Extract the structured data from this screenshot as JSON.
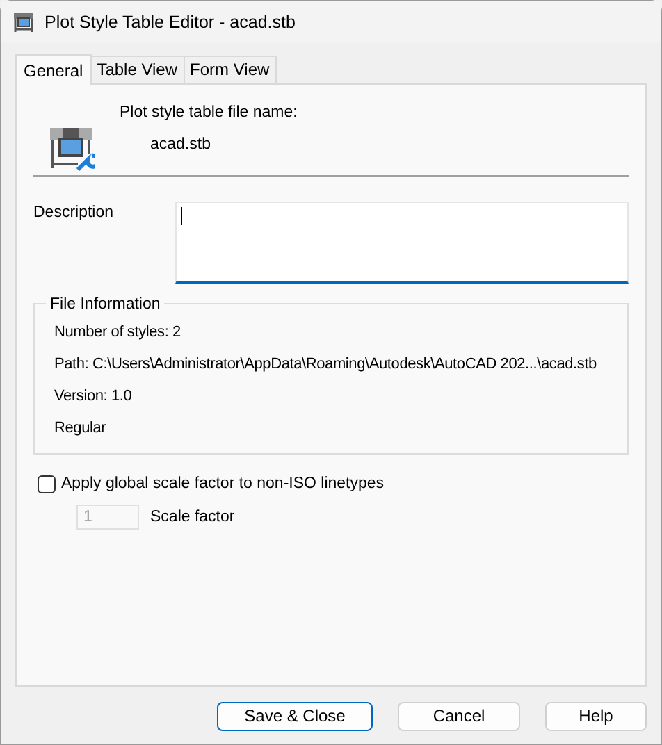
{
  "window": {
    "title": "Plot Style Table Editor - acad.stb"
  },
  "tabs": [
    {
      "label": "General",
      "selected": true
    },
    {
      "label": "Table View",
      "selected": false
    },
    {
      "label": "Form View",
      "selected": false
    }
  ],
  "file_name": {
    "label": "Plot style table file name:",
    "value": "acad.stb"
  },
  "description": {
    "label": "Description",
    "focused": true
  },
  "file_information": {
    "title": "File Information",
    "lines": [
      "Number of styles: 2",
      "Path: C:\\Users\\Administrator\\AppData\\Roaming\\Autodesk\\AutoCAD 202...\\acad.stb",
      "Version: 1.0",
      "Regular"
    ]
  },
  "apply_scale": {
    "label": "Apply global scale factor to non-ISO linetypes",
    "checked": false
  },
  "scale_factor": {
    "label": "Scale factor",
    "value": "1",
    "disabled": true
  },
  "buttons": [
    {
      "label": "Save & Close",
      "default": true
    },
    {
      "label": "Cancel",
      "default": false
    },
    {
      "label": "Help",
      "default": false
    }
  ]
}
